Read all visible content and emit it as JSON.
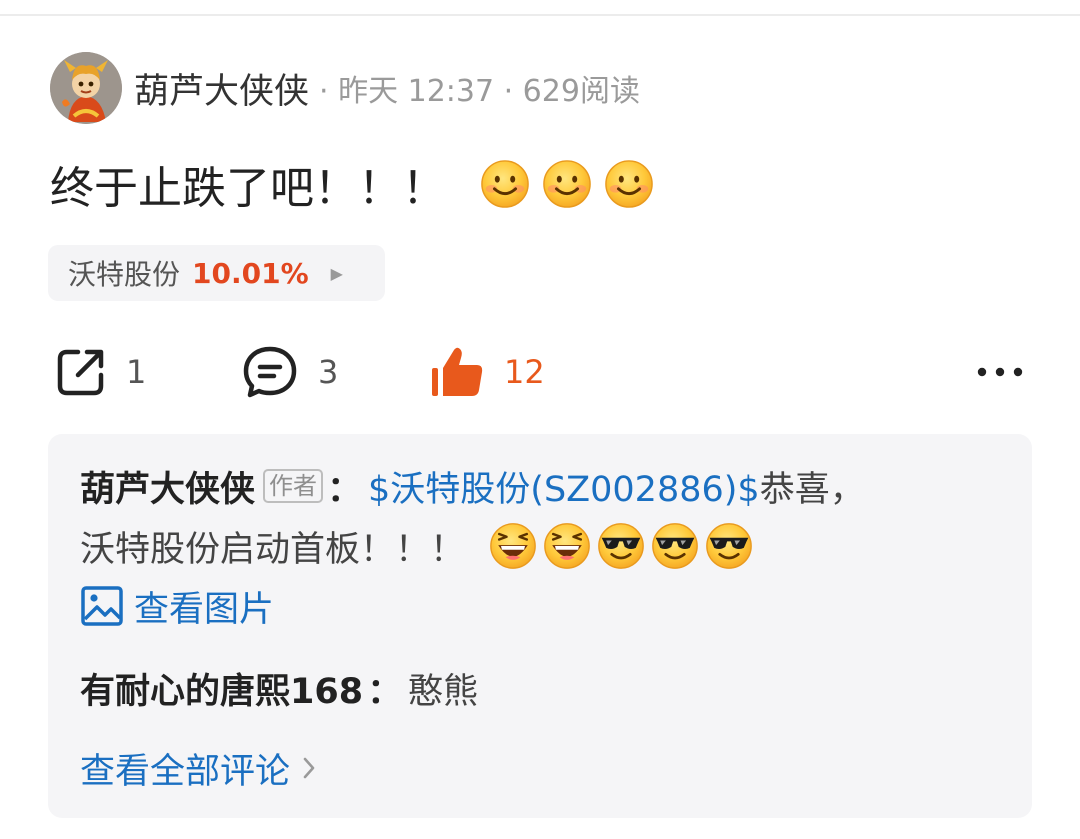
{
  "post": {
    "author": "葫芦大侠侠",
    "meta": "· 昨天 12:37 · 629阅读",
    "text": "终于止跌了吧！！！",
    "emojis": [
      "smile-emoji",
      "smile-emoji",
      "smile-emoji"
    ]
  },
  "stock_tag": {
    "name": "沃特股份",
    "change": "10.01%",
    "change_color": "#e2471f"
  },
  "actions": {
    "share_count": "1",
    "comment_count": "3",
    "like_count": "12",
    "like_color": "#e8591c",
    "icons": [
      "share-icon",
      "comment-icon",
      "like-icon",
      "more-icon"
    ]
  },
  "comments": [
    {
      "author": "葫芦大侠侠",
      "badge": "作者",
      "colon": "：",
      "link": "$沃特股份(SZ002886)$",
      "text_a": "恭喜，",
      "text_b": "沃特股份启动首板！！！",
      "emojis": [
        "laugh-emoji",
        "laugh-emoji",
        "cool-emoji",
        "cool-emoji",
        "cool-emoji"
      ],
      "view_image": "查看图片"
    },
    {
      "author": "有耐心的唐熙168",
      "colon": "：",
      "text": "憨熊"
    }
  ],
  "view_all": "查看全部评论",
  "link_color": "#1a6fc1"
}
